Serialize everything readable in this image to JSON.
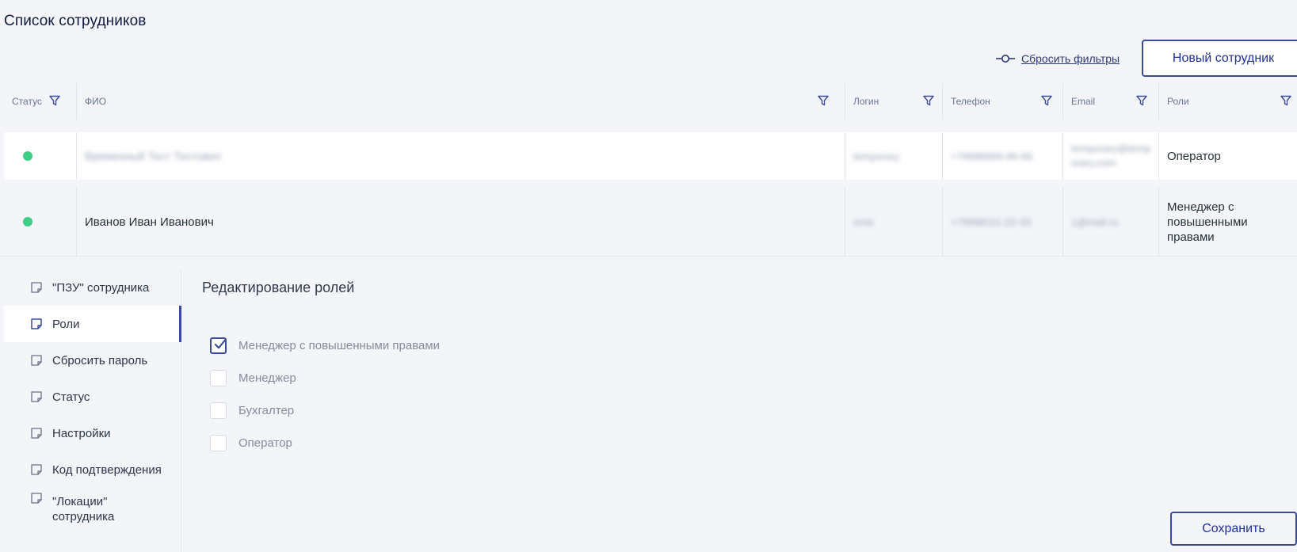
{
  "page_title": "Список сотрудников",
  "toolbar": {
    "reset_filters_label": "Сбросить фильтры",
    "new_employee_label": "Новый сотрудник"
  },
  "table": {
    "columns": [
      "Статус",
      "ФИО",
      "Логин",
      "Телефон",
      "Email",
      "Роли"
    ],
    "rows": [
      {
        "status": "active",
        "name": "Временный Тест Тестович",
        "login": "temporary",
        "phone": "+79998999-99-99",
        "email": "temporary@temporary.com",
        "roles": "Оператор"
      },
      {
        "status": "active",
        "name": "Иванов Иван Иванович",
        "login": "ivniv",
        "phone": "+79998111-22-33",
        "email": "1@mail.ru",
        "roles": "Менеджер с повышенными правами"
      }
    ]
  },
  "side_menu": {
    "items": [
      {
        "label": "\"ПЗУ\" сотрудника",
        "active": false
      },
      {
        "label": "Роли",
        "active": true
      },
      {
        "label": "Сбросить пароль",
        "active": false
      },
      {
        "label": "Статус",
        "active": false
      },
      {
        "label": "Настройки",
        "active": false
      },
      {
        "label": "Код подтверждения",
        "active": false
      },
      {
        "label": "\"Локации\" сотрудника",
        "active": false
      }
    ]
  },
  "roles_editor": {
    "title": "Редактирование ролей",
    "options": [
      {
        "label": "Менеджер с повышенными правами",
        "checked": true
      },
      {
        "label": "Менеджер",
        "checked": false
      },
      {
        "label": "Бухгалтер",
        "checked": false
      },
      {
        "label": "Оператор",
        "checked": false
      }
    ],
    "save_label": "Сохранить"
  },
  "colors": {
    "accent": "#3a4a9c",
    "status_active": "#3ecf86",
    "background": "#f3f5f9"
  },
  "icons": {
    "filter": "filter-icon",
    "reset": "reset-filter-icon",
    "menu_item": "note-icon",
    "check": "check-icon"
  }
}
